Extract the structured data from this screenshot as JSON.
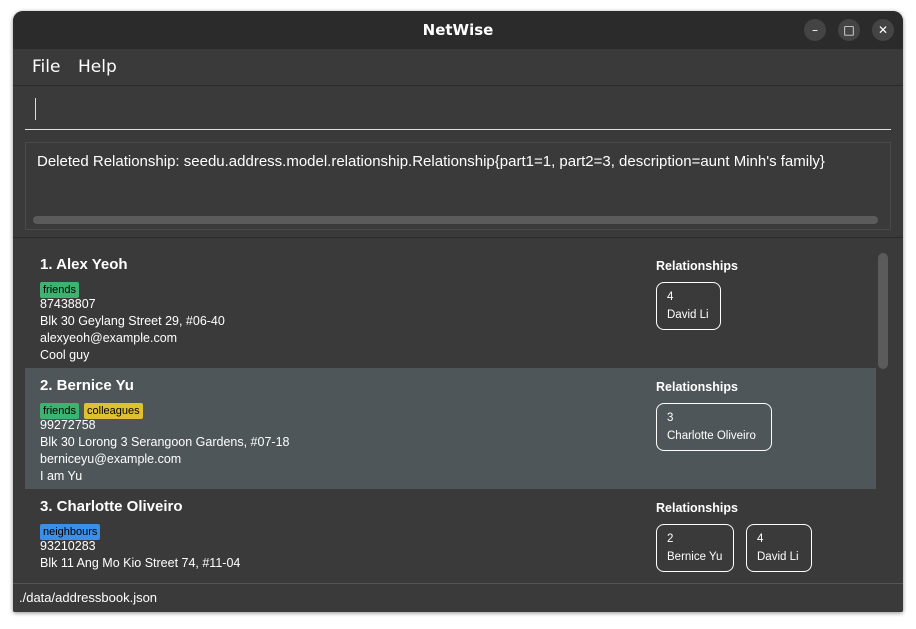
{
  "window": {
    "title": "NetWise",
    "controls": [
      "minimize",
      "maximize",
      "close"
    ]
  },
  "menu": {
    "file": "File",
    "help": "Help"
  },
  "command_box": {
    "value": "",
    "placeholder": ""
  },
  "result": {
    "text": "Deleted Relationship: seedu.address.model.relationship.Relationship{part1=1, part2=3, description=aunt Minh's family}"
  },
  "persons": [
    {
      "name": "1. Alex Yeoh",
      "tags": [
        {
          "label": "friends",
          "color": "#3cb371"
        }
      ],
      "phone": "87438807",
      "address": "Blk 30 Geylang Street 29, #06-40",
      "email": "alexyeoh@example.com",
      "description": "Cool guy",
      "relationships_label": "Relationships",
      "relationships": [
        {
          "id": "4",
          "name": "David Li"
        }
      ]
    },
    {
      "name": "2. Bernice Yu",
      "tags": [
        {
          "label": "friends",
          "color": "#3cb371"
        },
        {
          "label": "colleagues",
          "color": "#e0c030"
        }
      ],
      "phone": "99272758",
      "address": "Blk 30 Lorong 3 Serangoon Gardens, #07-18",
      "email": "berniceyu@example.com",
      "description": "I am Yu",
      "relationships_label": "Relationships",
      "relationships": [
        {
          "id": "3",
          "name": "Charlotte Oliveiro"
        }
      ]
    },
    {
      "name": "3. Charlotte Oliveiro",
      "tags": [
        {
          "label": "neighbours",
          "color": "#3a8fe8"
        }
      ],
      "phone": "93210283",
      "address": "Blk 11 Ang Mo Kio Street 74, #11-04",
      "relationships_label": "Relationships",
      "relationships": [
        {
          "id": "2",
          "name": "Bernice Yu"
        },
        {
          "id": "4",
          "name": "David Li"
        }
      ]
    }
  ],
  "status": {
    "path": "./data/addressbook.json"
  }
}
